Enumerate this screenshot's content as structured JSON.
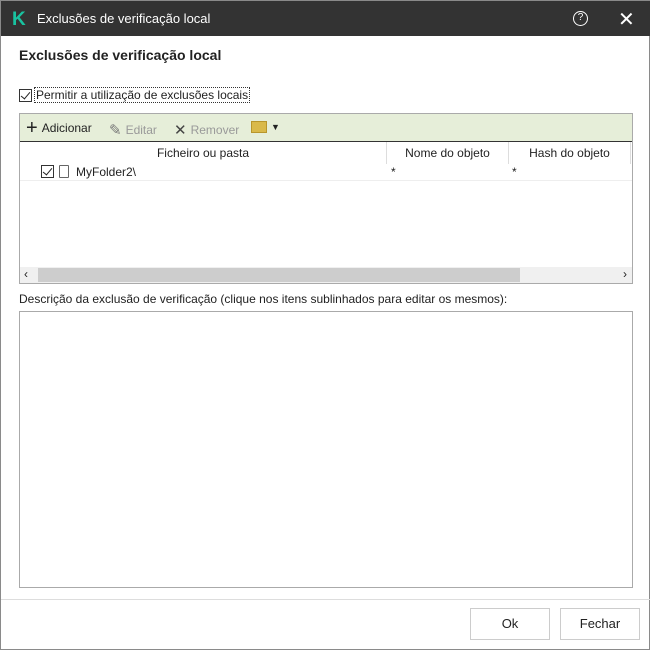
{
  "window": {
    "title": "Exclusões de verificação local",
    "logo": "K"
  },
  "heading": "Exclusões de verificação local",
  "allow_checkbox": {
    "label": "Permitir a utilização de exclusões locais",
    "checked": true
  },
  "toolbar": {
    "add": "Adicionar",
    "edit": "Editar",
    "remove": "Remover"
  },
  "table": {
    "columns": [
      "Ficheiro ou pasta",
      "Nome do objeto",
      "Hash do objeto"
    ],
    "rows": [
      {
        "path": "MyFolder2\\",
        "object_name": "*",
        "hash": "*",
        "checked": true
      }
    ]
  },
  "description_label": "Descrição da exclusão de verificação (clique nos itens sublinhados para editar os mesmos):",
  "buttons": {
    "ok": "Ok",
    "close": "Fechar"
  }
}
